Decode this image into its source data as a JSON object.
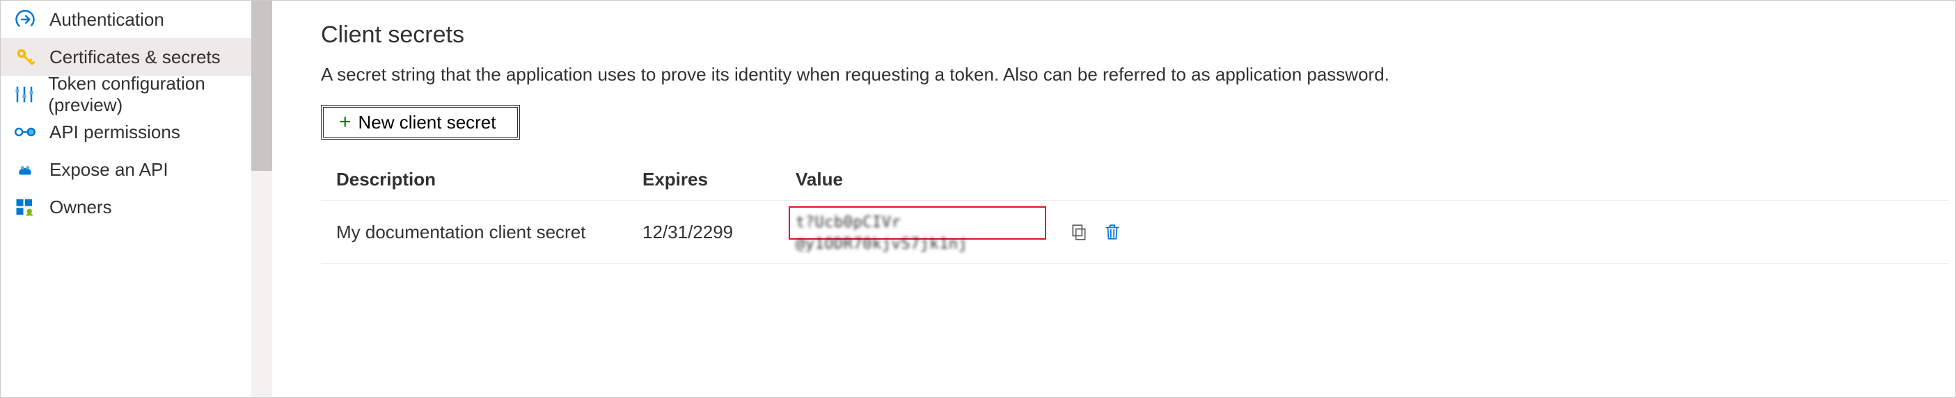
{
  "sidebar": {
    "items": [
      {
        "label": "Authentication"
      },
      {
        "label": "Certificates & secrets"
      },
      {
        "label": "Token configuration (preview)"
      },
      {
        "label": "API permissions"
      },
      {
        "label": "Expose an API"
      },
      {
        "label": "Owners"
      }
    ]
  },
  "main": {
    "title": "Client secrets",
    "description": "A secret string that the application uses to prove its identity when requesting a token. Also can be referred to as application password.",
    "new_button_label": "New client secret",
    "table": {
      "headers": {
        "description": "Description",
        "expires": "Expires",
        "value": "Value"
      },
      "rows": [
        {
          "description": "My documentation client secret",
          "expires": "12/31/2299",
          "value": "t?Ucb0pCIVr @y1ODR70kjvS7jk1nj"
        }
      ]
    }
  }
}
